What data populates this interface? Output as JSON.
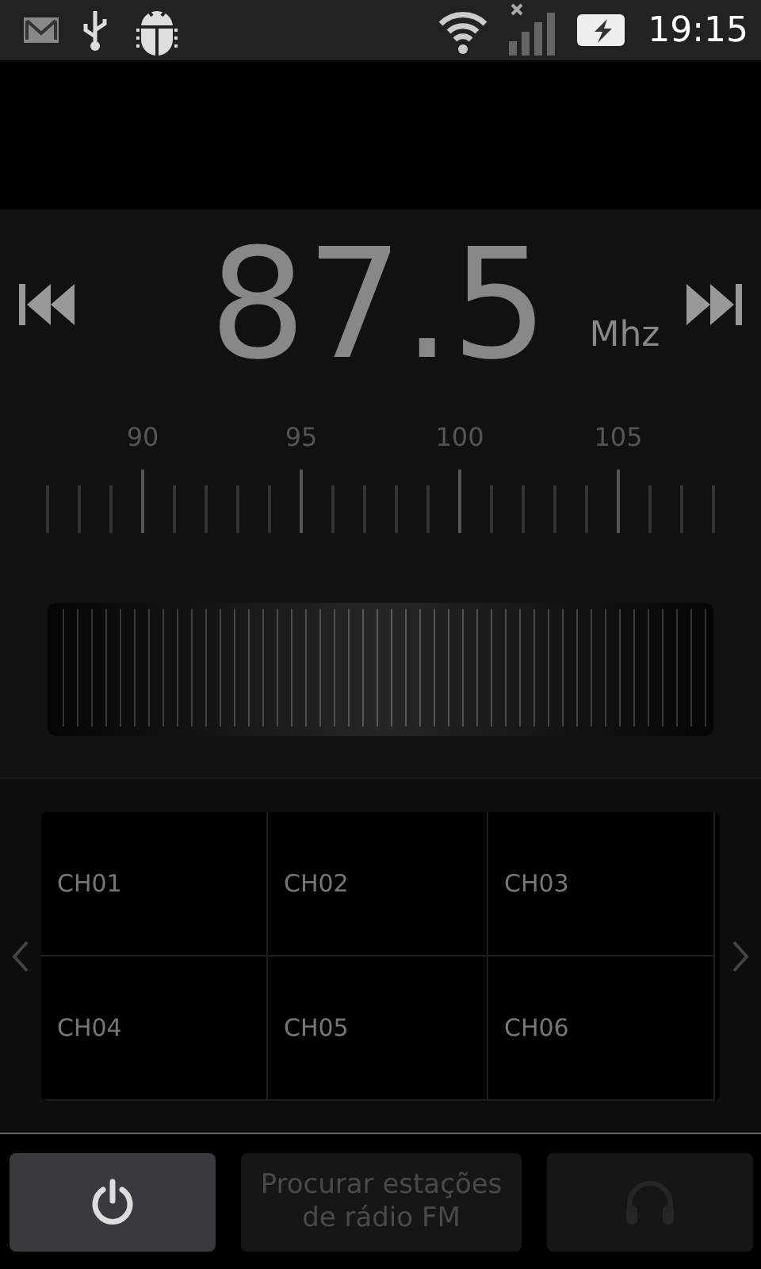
{
  "status_bar": {
    "time": "19:15"
  },
  "tuner": {
    "frequency": "87.5",
    "unit": "Mhz",
    "scale_labels": [
      "90",
      "95",
      "100",
      "105"
    ]
  },
  "presets": [
    {
      "label": "CH01"
    },
    {
      "label": "CH02"
    },
    {
      "label": "CH03"
    },
    {
      "label": "CH04"
    },
    {
      "label": "CH05"
    },
    {
      "label": "CH06"
    }
  ],
  "buttons": [
    {
      "kind": "power",
      "disabled": false
    },
    {
      "kind": "text",
      "label": "Procurar estações de rádio FM",
      "disabled": true
    },
    {
      "kind": "headphones",
      "disabled": true
    }
  ]
}
